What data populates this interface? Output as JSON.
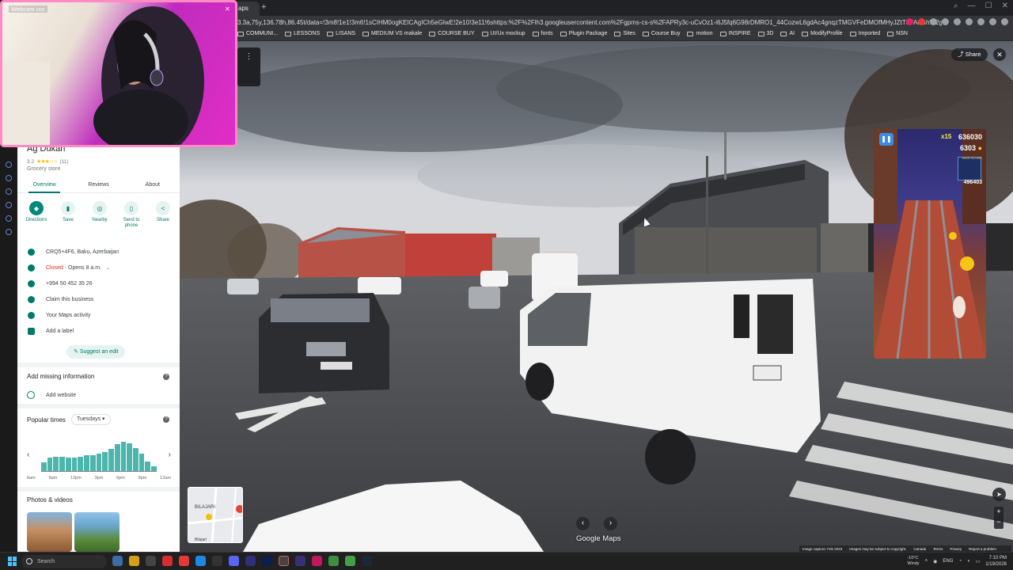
{
  "browser": {
    "active_tab_label": "aps",
    "url": "3.3a,75y,136.78h,86.45t/data=!3m8!1e1!3m6!1sCIHM0ogKEICAgICh5eGIwE!2e10!3e11!6shttps:%2F%2Flh3.googleusercontent.com%2Fgpms-cs-s%2FAPRy3c-uCvOz1-i6J5fq6G98rDMRO1_44CozwL6gdAc4gnqzTMGVFeDMOfMHyJZtT0PAuGhW2gVe69gQnz0AFJcNUSszGV9F7MX0g",
    "bookmarks": [
      "COMMUNI...",
      "LESSONS",
      "LISANS",
      "MEDIUM VS makale",
      "COURSE BUY",
      "UI/Ux mockup",
      "fonts",
      "Plugin Package",
      "Sites",
      "Course Buy",
      "motion",
      "INSPIRE",
      "3D",
      "AI",
      "ModifyProfile",
      "Imported",
      "NSN"
    ]
  },
  "webcam": {
    "title": "Webcam ccc"
  },
  "place": {
    "name": "Ag Dukan",
    "rating": "3.2",
    "stars": "★★★☆☆",
    "review_count": "(11)",
    "category": "Grocery store",
    "tabs": [
      "Overview",
      "Reviews",
      "About"
    ],
    "actions": [
      "Directions",
      "Save",
      "Nearby",
      "Send to phone",
      "Share"
    ],
    "address": "CRQ5+4F6, Baku, Azerbaijan",
    "hours_status": "Closed",
    "hours_detail": " · Opens 8 a.m.",
    "phone": "+994 50 452 35 26",
    "claim": "Claim this business",
    "maps_activity": "Your Maps activity",
    "add_label": "Add a label",
    "suggest_edit": "Suggest an edit",
    "missing_info_title": "Add missing information",
    "add_website": "Add website",
    "popular_times_title": "Popular times",
    "popular_day": "Tuesdays",
    "popular_times": [
      0.28,
      0.42,
      0.44,
      0.45,
      0.43,
      0.42,
      0.45,
      0.5,
      0.5,
      0.55,
      0.6,
      0.7,
      0.85,
      0.92,
      0.88,
      0.72,
      0.55,
      0.3,
      0.15
    ],
    "popular_ticks": [
      "6am",
      "9am",
      "12pm",
      "3pm",
      "6pm",
      "9pm",
      "12am"
    ],
    "photos_title": "Photos & videos"
  },
  "streetview": {
    "share_label": "Share",
    "logo": "Google Maps",
    "minimap_label": "BILAJARI",
    "minimap_label2": "Bilajari",
    "footer": [
      "Image capture: Feb 2023",
      "Images may be subject to copyright.",
      "Canada",
      "Terms",
      "Privacy",
      "Report a problem"
    ]
  },
  "game": {
    "score": "636030",
    "multiplier": "x15",
    "coins": "6303",
    "high_score_label": "HIGH SCORE",
    "high_score": "496403"
  },
  "taskbar": {
    "search_placeholder": "Search",
    "weather_temp": "-10°C",
    "weather_desc": "Windy",
    "lang": "ENG",
    "time": "7:10 PM",
    "date": "1/19/2026"
  }
}
